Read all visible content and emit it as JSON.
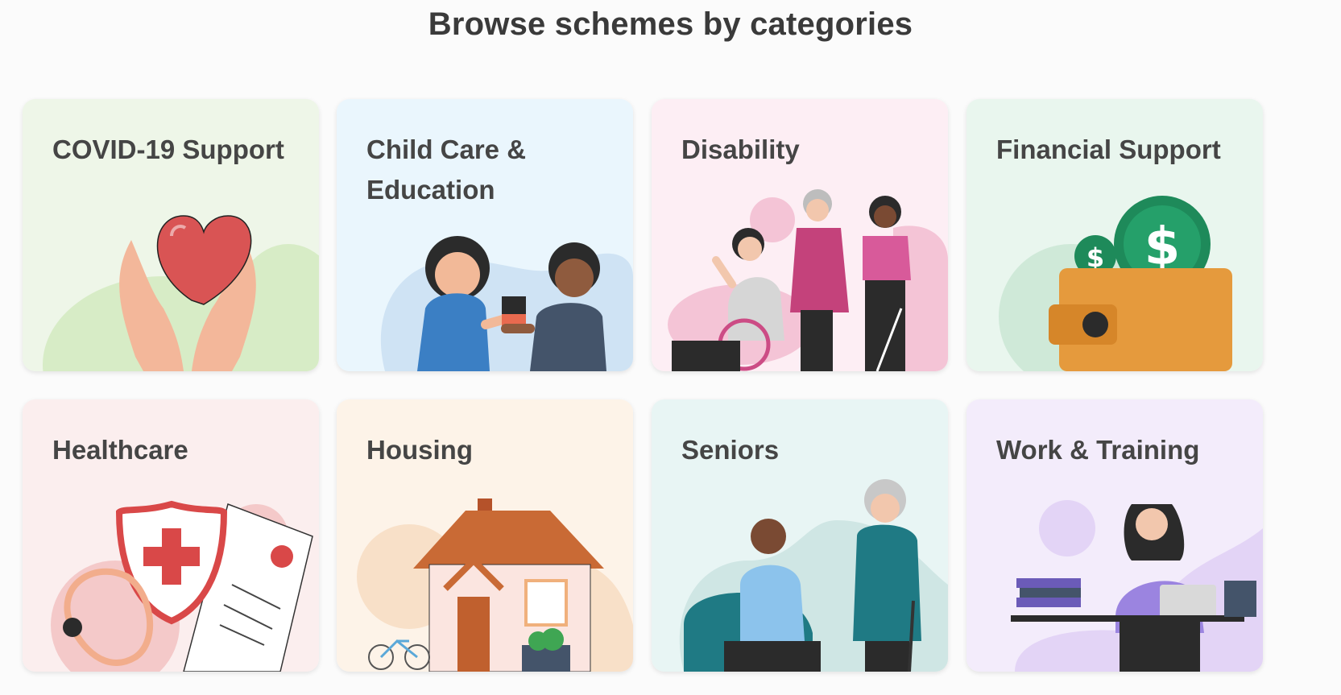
{
  "page": {
    "title": "Browse schemes by categories"
  },
  "categories": [
    {
      "label": "COVID-19 Support",
      "bg": "#eef6e8",
      "icon": "heart-hands-illustration"
    },
    {
      "label": "Child Care & Education",
      "bg": "#eaf6fd",
      "icon": "children-playing-illustration"
    },
    {
      "label": "Disability",
      "bg": "#fdeef4",
      "icon": "disability-group-illustration"
    },
    {
      "label": "Financial Support",
      "bg": "#e9f6ee",
      "icon": "wallet-dollar-illustration"
    },
    {
      "label": "Healthcare",
      "bg": "#fbeeee",
      "icon": "medical-shield-illustration"
    },
    {
      "label": "Housing",
      "bg": "#fdf3e8",
      "icon": "house-illustration"
    },
    {
      "label": "Seniors",
      "bg": "#e8f5f4",
      "icon": "seniors-illustration"
    },
    {
      "label": "Work & Training",
      "bg": "#f3ecfb",
      "icon": "person-laptop-illustration"
    }
  ]
}
